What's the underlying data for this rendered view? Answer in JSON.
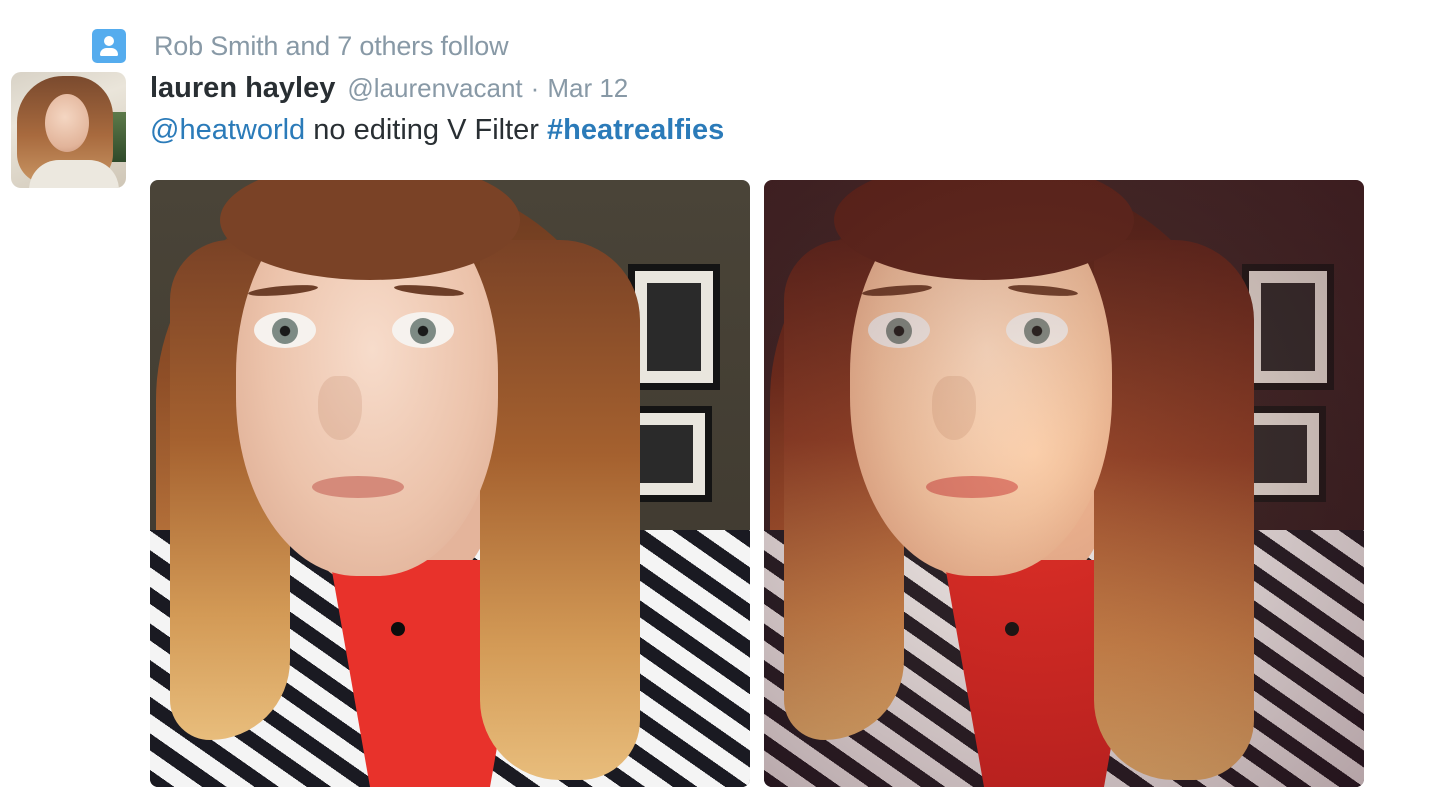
{
  "context": {
    "text": "Rob Smith and 7 others follow",
    "icon": "person-icon",
    "icon_color": "#55acee"
  },
  "tweet": {
    "display_name": "lauren hayley",
    "handle": "@laurenvacant",
    "separator": "·",
    "timestamp": "Mar 12",
    "text": {
      "mention": "@heatworld",
      "body": "no editing V Filter",
      "hashtag": "#heatrealfies"
    },
    "link_color": "#2b7bb9"
  },
  "photos": [
    {
      "name": "photo-no-editing"
    },
    {
      "name": "photo-v-filter"
    }
  ]
}
